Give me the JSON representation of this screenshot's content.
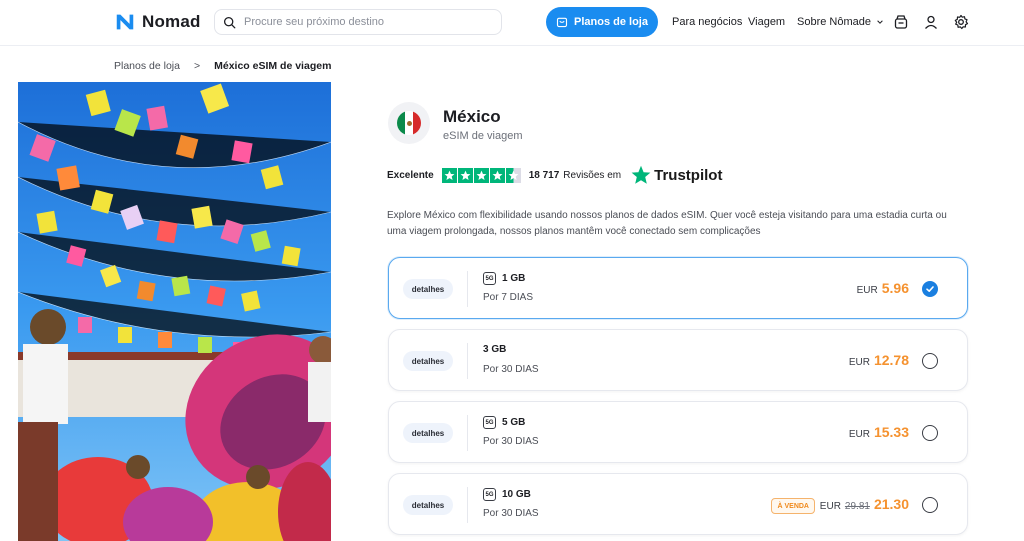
{
  "brand": {
    "name": "Nomad",
    "accent": "#1a8cf0"
  },
  "search": {
    "placeholder": "Procure seu próximo destino"
  },
  "nav": {
    "cta_label": "Planos de loja",
    "business": "Para negócios",
    "travel": "Viagem",
    "about": "Sobre Nômade",
    "icons": [
      "store-bag-icon",
      "user-icon",
      "gear-icon"
    ]
  },
  "breadcrumb": {
    "parent": "Planos de loja",
    "separator": ">",
    "current": "México eSIM de viagem"
  },
  "product": {
    "title": "México",
    "subtitle": "eSIM de viagem",
    "rating_label": "Excelente",
    "rating_stars": 4.5,
    "review_count": "18 717",
    "review_text": "Revisões em",
    "trustpilot": "Trustpilot",
    "description": "Explore México com flexibilidade usando nossos planos de dados eSIM. Quer você esteja visitando para uma estadia curta ou uma viagem prolongada, nossos planos mantêm você conectado sem complicações"
  },
  "plans": [
    {
      "details": "detalhes",
      "badge_5g": "5G",
      "data": "1 GB",
      "period": "Por 7 DIAS",
      "currency": "EUR",
      "price": "5.96",
      "selected": true
    },
    {
      "details": "detalhes",
      "badge_5g": "",
      "data": "3 GB",
      "period": "Por 30 DIAS",
      "currency": "EUR",
      "price": "12.78",
      "selected": false
    },
    {
      "details": "detalhes",
      "badge_5g": "5G",
      "data": "5 GB",
      "period": "Por 30 DIAS",
      "currency": "EUR",
      "price": "15.33",
      "selected": false
    },
    {
      "details": "detalhes",
      "badge_5g": "5G",
      "data": "10 GB",
      "period": "Por 30 DIAS",
      "currency": "EUR",
      "old_price": "29.81",
      "price": "21.30",
      "sale_label": "À VENDA",
      "selected": false
    }
  ]
}
